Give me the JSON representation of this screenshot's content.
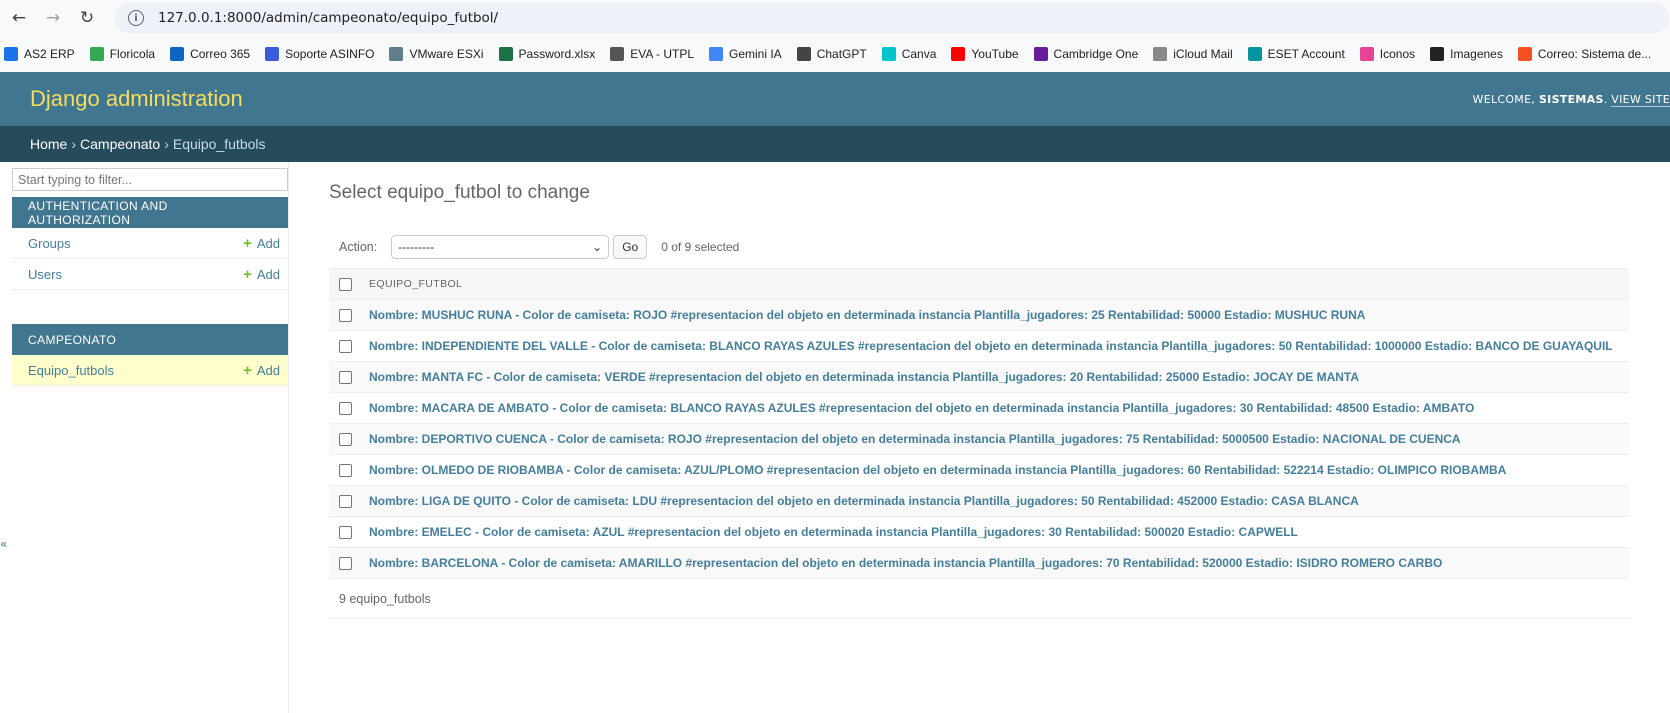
{
  "browser": {
    "url": "127.0.0.1:8000/admin/campeonato/equipo_futbol/",
    "back_icon": "arrow-left-icon",
    "forward_icon": "arrow-right-icon",
    "reload_icon": "reload-icon",
    "site_info_icon": "info-icon"
  },
  "bookmarks": [
    {
      "label": "AS2 ERP",
      "color": "#1a73e8"
    },
    {
      "label": "Floricola",
      "color": "#34a853"
    },
    {
      "label": "Correo 365",
      "color": "#0a66c2"
    },
    {
      "label": "Soporte ASINFO",
      "color": "#3b5bdb"
    },
    {
      "label": "VMware ESXi",
      "color": "#607d8b"
    },
    {
      "label": "Password.xlsx",
      "color": "#1e7145"
    },
    {
      "label": "EVA - UTPL",
      "color": "#555555"
    },
    {
      "label": "Gemini IA",
      "color": "#4285f4"
    },
    {
      "label": "ChatGPT",
      "color": "#444444"
    },
    {
      "label": "Canva",
      "color": "#00c4cc"
    },
    {
      "label": "YouTube",
      "color": "#ff0000"
    },
    {
      "label": "Cambridge One",
      "color": "#6a1b9a"
    },
    {
      "label": "iCloud Mail",
      "color": "#888888"
    },
    {
      "label": "ESET  Account",
      "color": "#0096a0"
    },
    {
      "label": "Iconos",
      "color": "#e84393"
    },
    {
      "label": "Imagenes",
      "color": "#222222"
    },
    {
      "label": "Correo: Sistema de...",
      "color": "#f25022"
    }
  ],
  "header": {
    "branding": "Django administration",
    "welcome": "WELCOME, ",
    "username": "SISTEMAS",
    "view_site": "VIEW SITE"
  },
  "breadcrumbs": {
    "home": "Home",
    "app": "Campeonato",
    "current": "Equipo_futbols",
    "separator": "›"
  },
  "sidebar": {
    "filter_placeholder": "Start typing to filter...",
    "auth_caption": "AUTHENTICATION AND AUTHORIZATION",
    "auth_items": [
      {
        "name": "Groups",
        "add": "Add"
      },
      {
        "name": "Users",
        "add": "Add"
      }
    ],
    "app_caption": "CAMPEONATO",
    "app_items": [
      {
        "name": "Equipo_futbols",
        "add": "Add"
      }
    ],
    "collapse": "«"
  },
  "content": {
    "title": "Select equipo_futbol to change",
    "action_label": "Action:",
    "action_value": "---------",
    "go": "Go",
    "selected": "0 of 9 selected",
    "column_header": "EQUIPO_FUTBOL",
    "rows": [
      "Nombre: MUSHUC RUNA - Color de camiseta: ROJO #representacion del objeto en determinada instancia Plantilla_jugadores: 25 Rentabilidad: 50000 Estadio: MUSHUC RUNA",
      "Nombre: INDEPENDIENTE DEL VALLE - Color de camiseta: BLANCO RAYAS AZULES #representacion del objeto en determinada instancia Plantilla_jugadores: 50 Rentabilidad: 1000000 Estadio: BANCO DE GUAYAQUIL",
      "Nombre: MANTA FC - Color de camiseta: VERDE #representacion del objeto en determinada instancia Plantilla_jugadores: 20 Rentabilidad: 25000 Estadio: JOCAY DE MANTA",
      "Nombre: MACARA DE AMBATO - Color de camiseta: BLANCO RAYAS AZULES #representacion del objeto en determinada instancia Plantilla_jugadores: 30 Rentabilidad: 48500 Estadio: AMBATO",
      "Nombre: DEPORTIVO CUENCA - Color de camiseta: ROJO #representacion del objeto en determinada instancia Plantilla_jugadores: 75 Rentabilidad: 5000500 Estadio: NACIONAL DE CUENCA",
      "Nombre: OLMEDO DE RIOBAMBA - Color de camiseta: AZUL/PLOMO #representacion del objeto en determinada instancia Plantilla_jugadores: 60 Rentabilidad: 522214 Estadio: OLIMPICO RIOBAMBA",
      "Nombre: LIGA DE QUITO - Color de camiseta: LDU #representacion del objeto en determinada instancia Plantilla_jugadores: 50 Rentabilidad: 452000 Estadio: CASA BLANCA",
      "Nombre: EMELEC - Color de camiseta: AZUL #representacion del objeto en determinada instancia Plantilla_jugadores: 30 Rentabilidad: 500020 Estadio: CAPWELL",
      "Nombre: BARCELONA - Color de camiseta: AMARILLO #representacion del objeto en determinada instancia Plantilla_jugadores: 70 Rentabilidad: 520000 Estadio: ISIDRO ROMERO CARBO"
    ],
    "paginator": "9 equipo_futbols"
  },
  "colors": {
    "header_bg": "#417690",
    "breadcrumbs_bg": "#264b5d",
    "branding": "#f5dd5d",
    "link": "#447e9b",
    "add_icon": "#70bf2b",
    "current_row": "#ffffcc"
  }
}
